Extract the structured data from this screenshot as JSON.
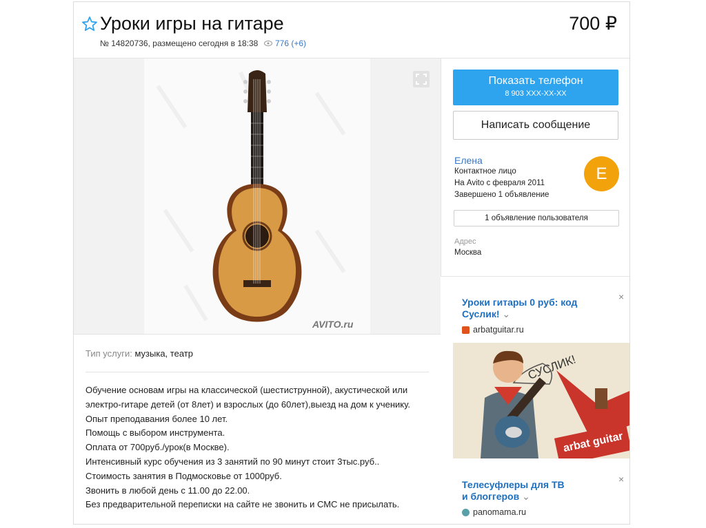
{
  "header": {
    "title": "Уроки игры на гитаре",
    "meta": "№ 14820736, размещено сегодня в 18:38",
    "views": "776 (+6)",
    "price": "700 ₽"
  },
  "photo": {
    "watermark": "AVITO.ru"
  },
  "description": {
    "service_label": "Тип услуги:",
    "service_value": "музыка, театр",
    "lines": [
      "Обучение основам игры на классической (шестиструнной), акустической или",
      "электро-гитаре детей (от 8лет) и взрослых (до 60лет),выезд на дом к ученику.",
      "Опыт преподавания более 10 лет.",
      "Помощь с выбором инструмента.",
      "Оплата от 700руб./урок(в Москве).",
      "Интенсивный курс обучения из 3 занятий по 90 минут стоит 3тыс.руб..",
      "Стоимость занятия в Подмосковье от 1000руб.",
      "Звонить в любой день с 11.00 до 22.00.",
      "Без предварительной переписки на сайте не звонить и СМС не присылать."
    ]
  },
  "actions": {
    "show_phone": "Показать телефон",
    "phone_masked": "8 903 XXX-XX-XX",
    "write_message": "Написать сообщение"
  },
  "seller": {
    "name": "Елена",
    "role": "Контактное лицо",
    "since": "На Avito с февраля 2011",
    "completed": "Завершено 1 объявление",
    "avatar_letter": "Е",
    "ads_button": "1 объявление пользователя",
    "address_label": "Адрес",
    "address_value": "Москва"
  },
  "ads": [
    {
      "title_line1": "Уроки гитары 0 руб: код",
      "title_line2": "Суслик!",
      "domain": "arbatguitar.ru",
      "image_text": "СУСЛИК!",
      "brand": "arbat guitar"
    },
    {
      "title_line1": "Телесуфлеры для ТВ",
      "title_line2": "и блоггеров",
      "domain": "panomama.ru"
    }
  ],
  "colors": {
    "accent_blue": "#2ea3ee",
    "link_blue": "#3877c4",
    "avatar_orange": "#f2a20a"
  }
}
